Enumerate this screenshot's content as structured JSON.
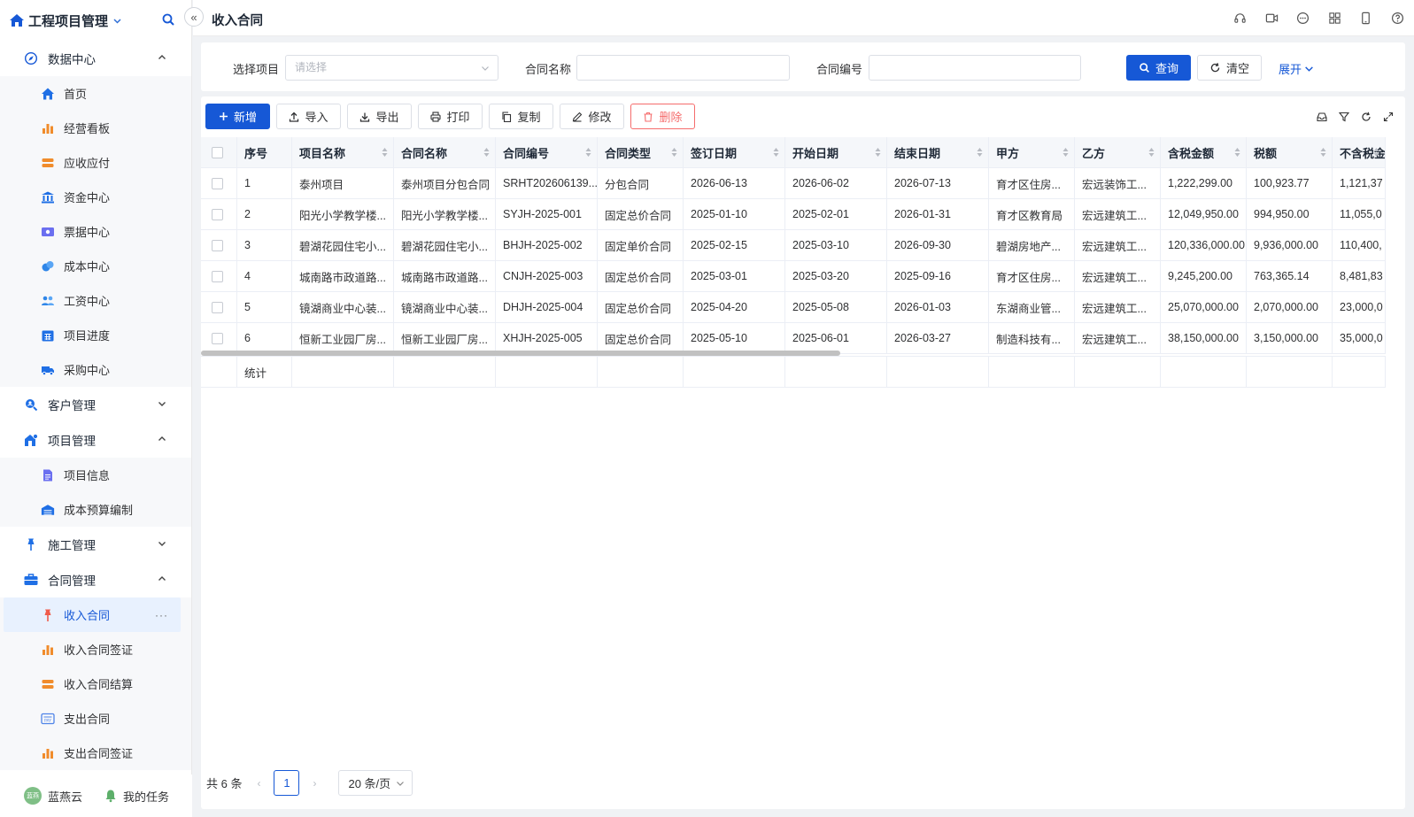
{
  "app": {
    "name": "工程项目管理",
    "collapse_glyph": "«"
  },
  "sidebar": {
    "groups": [
      {
        "label": "数据中心",
        "icon": "compass-icon",
        "expanded": true,
        "items": [
          {
            "label": "首页",
            "icon": "home-icon"
          },
          {
            "label": "经营看板",
            "icon": "bar-chart-icon"
          },
          {
            "label": "应收应付",
            "icon": "card-icon"
          },
          {
            "label": "资金中心",
            "icon": "bank-icon"
          },
          {
            "label": "票据中心",
            "icon": "ticket-icon"
          },
          {
            "label": "成本中心",
            "icon": "coins-icon"
          },
          {
            "label": "工资中心",
            "icon": "users-icon"
          },
          {
            "label": "项目进度",
            "icon": "calendar-icon"
          },
          {
            "label": "采购中心",
            "icon": "truck-icon"
          }
        ]
      },
      {
        "label": "客户管理",
        "icon": "search-user-icon",
        "expanded": false
      },
      {
        "label": "项目管理",
        "icon": "building-icon",
        "expanded": true,
        "items": [
          {
            "label": "项目信息",
            "icon": "document-icon"
          },
          {
            "label": "成本预算编制",
            "icon": "warehouse-icon"
          }
        ]
      },
      {
        "label": "施工管理",
        "icon": "pin-icon",
        "expanded": false
      },
      {
        "label": "合同管理",
        "icon": "briefcase-icon",
        "expanded": true,
        "items": [
          {
            "label": "收入合同",
            "icon": "pin-icon",
            "active": true,
            "more": "···"
          },
          {
            "label": "收入合同签证",
            "icon": "bar-chart-icon"
          },
          {
            "label": "收入合同结算",
            "icon": "card-icon"
          },
          {
            "label": "支出合同",
            "icon": "pay-icon"
          },
          {
            "label": "支出合同签证",
            "icon": "bar-chart-icon"
          }
        ]
      }
    ],
    "footer": {
      "avatar_text": "蓝燕",
      "user": "蓝燕云",
      "tasks": "我的任务"
    }
  },
  "header": {
    "title": "收入合同"
  },
  "search": {
    "project_label": "选择项目",
    "project_placeholder": "请选择",
    "contract_name_label": "合同名称",
    "contract_name_value": "",
    "contract_no_label": "合同编号",
    "contract_no_value": "",
    "query_label": "查询",
    "clear_label": "清空",
    "expand_label": "展开"
  },
  "toolbar": {
    "add": "新增",
    "import": "导入",
    "export": "导出",
    "print": "打印",
    "copy": "复制",
    "edit": "修改",
    "delete": "删除"
  },
  "table": {
    "columns": [
      "序号",
      "项目名称",
      "合同名称",
      "合同编号",
      "合同类型",
      "签订日期",
      "开始日期",
      "结束日期",
      "甲方",
      "乙方",
      "含税金额",
      "税额",
      "不含税金"
    ],
    "rows": [
      [
        "1",
        "泰州项目",
        "泰州项目分包合同",
        "SRHT202606139...",
        "分包合同",
        "2026-06-13",
        "2026-06-02",
        "2026-07-13",
        "育才区住房...",
        "宏远装饰工...",
        "1,222,299.00",
        "100,923.77",
        "1,121,37"
      ],
      [
        "2",
        "阳光小学教学楼...",
        "阳光小学教学楼...",
        "SYJH-2025-001",
        "固定总价合同",
        "2025-01-10",
        "2025-02-01",
        "2026-01-31",
        "育才区教育局",
        "宏远建筑工...",
        "12,049,950.00",
        "994,950.00",
        "11,055,0"
      ],
      [
        "3",
        "碧湖花园住宅小...",
        "碧湖花园住宅小...",
        "BHJH-2025-002",
        "固定单价合同",
        "2025-02-15",
        "2025-03-10",
        "2026-09-30",
        "碧湖房地产...",
        "宏远建筑工...",
        "120,336,000.00",
        "9,936,000.00",
        "110,400,"
      ],
      [
        "4",
        "城南路市政道路...",
        "城南路市政道路...",
        "CNJH-2025-003",
        "固定总价合同",
        "2025-03-01",
        "2025-03-20",
        "2025-09-16",
        "育才区住房...",
        "宏远建筑工...",
        "9,245,200.00",
        "763,365.14",
        "8,481,83"
      ],
      [
        "5",
        "镜湖商业中心装...",
        "镜湖商业中心装...",
        "DHJH-2025-004",
        "固定总价合同",
        "2025-04-20",
        "2025-05-08",
        "2026-01-03",
        "东湖商业管...",
        "宏远建筑工...",
        "25,070,000.00",
        "2,070,000.00",
        "23,000,0"
      ],
      [
        "6",
        "恒新工业园厂房...",
        "恒新工业园厂房...",
        "XHJH-2025-005",
        "固定总价合同",
        "2025-05-10",
        "2025-06-01",
        "2026-03-27",
        "制造科技有...",
        "宏远建筑工...",
        "38,150,000.00",
        "3,150,000.00",
        "35,000,0"
      ]
    ],
    "summary_label": "统计"
  },
  "pagination": {
    "total": "共 6 条",
    "current_page": "1",
    "page_size": "20 条/页",
    "prev": "‹",
    "next": "›"
  },
  "colors": {
    "primary": "#1658d6",
    "danger": "#f56c6c",
    "active_bg": "#e8f1fe"
  }
}
